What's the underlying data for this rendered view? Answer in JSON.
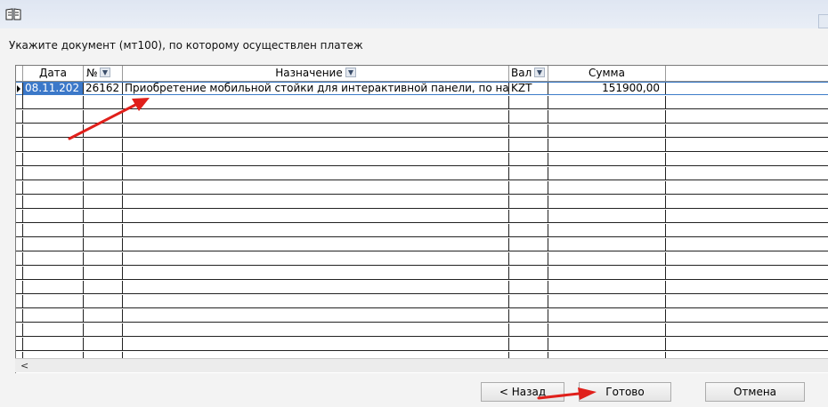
{
  "window": {
    "icon": "book-icon"
  },
  "prompt_text": "Укажите документ (мт100), по которому осуществлен платеж",
  "table": {
    "columns": [
      {
        "label": "Дата",
        "filter": false
      },
      {
        "label": "№",
        "filter": true
      },
      {
        "label": "Назначение",
        "filter": true
      },
      {
        "label": "Вал",
        "filter": true
      },
      {
        "label": "Сумма",
        "filter": false
      }
    ],
    "rows": [
      {
        "date": "08.11.202",
        "number": "26162",
        "purpose": "Приобретение мобильной стойки для интерактивной панели, по на",
        "currency": "KZT",
        "amount": "151900,00",
        "selected": true
      }
    ]
  },
  "scrollbar": {
    "left_arrow": "<"
  },
  "buttons": {
    "back": "< Назад",
    "done": "Готово",
    "cancel": "Отмена"
  },
  "colors": {
    "selection": "#3b78c9",
    "annotation_arrow": "#e0201b"
  }
}
